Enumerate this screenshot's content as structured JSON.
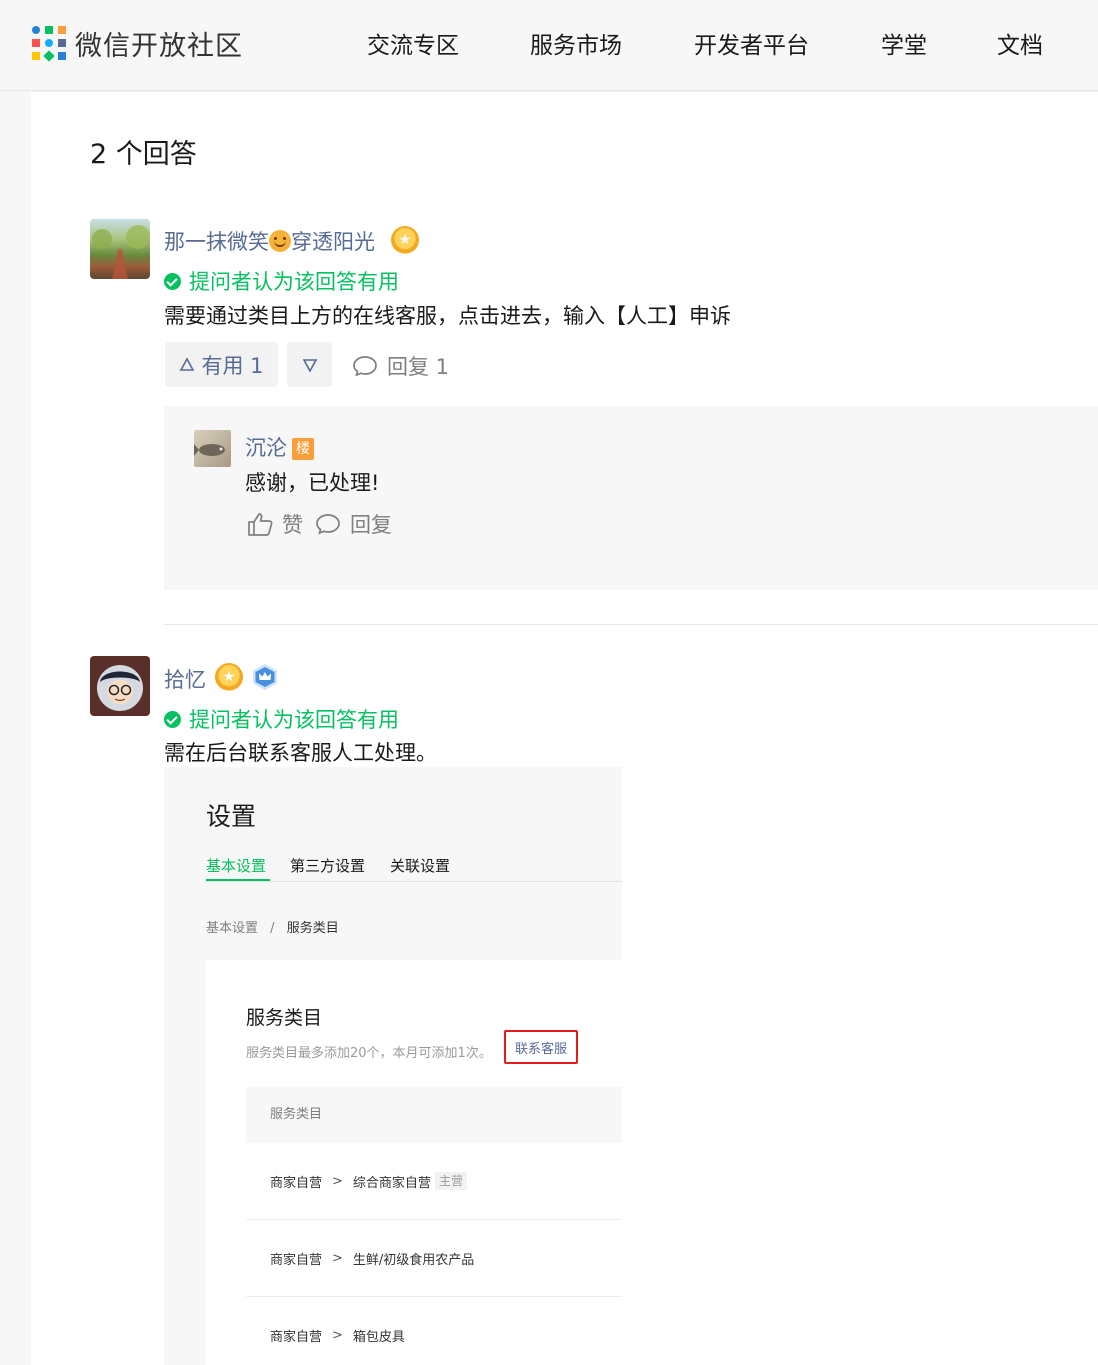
{
  "header": {
    "brand": "微信开放社区",
    "nav": [
      "交流专区",
      "服务市场",
      "开发者平台",
      "学堂",
      "文档"
    ]
  },
  "answers": {
    "count_title": "2 个回答",
    "first": {
      "username_a": "那一抹微笑",
      "username_b": "穿透阳光",
      "helpful_text": "提问者认为该回答有用",
      "content": "需要通过类目上方的在线客服，点击进去，输入【人工】申诉",
      "upvote_label": "有用 1",
      "reply_label": "回复 1",
      "reply": {
        "username": "沉沦",
        "floor_tag": "楼",
        "content": "感谢，已处理!",
        "like_label": "赞",
        "reply_label": "回复"
      }
    },
    "second": {
      "username": "拾忆",
      "helpful_text": "提问者认为该回答有用",
      "content": "需在后台联系客服人工处理。",
      "screenshot": {
        "title": "设置",
        "tabs": [
          "基本设置",
          "第三方设置",
          "关联设置"
        ],
        "breadcrumb_parent": "基本设置",
        "breadcrumb_sep": "/",
        "breadcrumb_current": "服务类目",
        "card_title": "服务类目",
        "note": "服务类目最多添加20个，本月可添加1次。",
        "contact_link": "联系客服",
        "column_header": "服务类目",
        "rows": [
          {
            "parent": "商家自营",
            "sep": ">",
            "child": "综合商家自营",
            "tag": "主营"
          },
          {
            "parent": "商家自营",
            "sep": ">",
            "child": "生鲜/初级食用农产品",
            "tag": ""
          },
          {
            "parent": "商家自营",
            "sep": ">",
            "child": "箱包皮具",
            "tag": ""
          }
        ]
      }
    }
  },
  "colors": {
    "accent_green": "#07c160",
    "link_blue": "#576b95",
    "floor_orange": "#fa9d3b",
    "highlight_red": "#e21d1d"
  }
}
